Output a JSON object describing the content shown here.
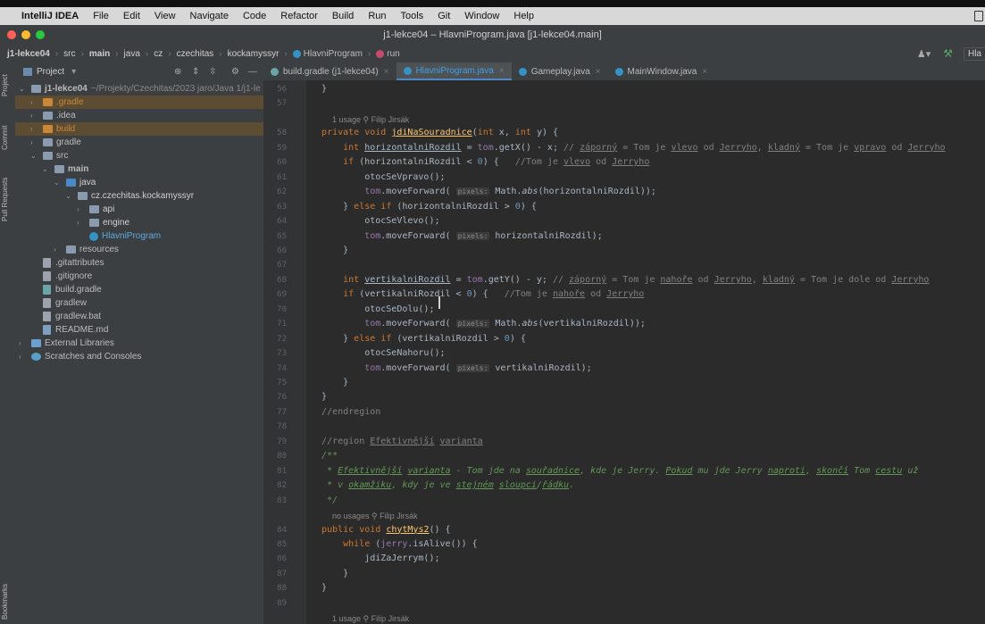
{
  "menubar": {
    "apple": "",
    "app": "IntelliJ IDEA",
    "items": [
      "File",
      "Edit",
      "View",
      "Navigate",
      "Code",
      "Refactor",
      "Build",
      "Run",
      "Tools",
      "Git",
      "Window",
      "Help"
    ]
  },
  "window": {
    "title": "j1-lekce04 – HlavniProgram.java [j1-lekce04.main]"
  },
  "breadcrumbs": [
    "j1-lekce04",
    "src",
    "main",
    "java",
    "cz",
    "czechitas",
    "kockamyssyr",
    "HlavniProgram",
    "run"
  ],
  "navbar_right": {
    "cut_label": "Hla"
  },
  "left_toolbar": [
    "Project",
    "Commit",
    "Pull Requests",
    "Bookmarks"
  ],
  "project_panel": {
    "title": "Project",
    "tree": [
      {
        "label": "j1-lekce04",
        "suffix": "~/Projekty/Czechitas/2023 jaro/Java 1/j1-le",
        "depth": 0,
        "arrow": "down",
        "icon": "module",
        "bold": true
      },
      {
        "label": ".gradle",
        "depth": 1,
        "arrow": "right",
        "icon": "folder-orange",
        "hl": true
      },
      {
        "label": ".idea",
        "depth": 1,
        "arrow": "right",
        "icon": "folder"
      },
      {
        "label": "build",
        "depth": 1,
        "arrow": "right",
        "icon": "folder-orange",
        "hl": true
      },
      {
        "label": "gradle",
        "depth": 1,
        "arrow": "right",
        "icon": "folder"
      },
      {
        "label": "src",
        "depth": 1,
        "arrow": "down",
        "icon": "folder"
      },
      {
        "label": "main",
        "depth": 2,
        "arrow": "down",
        "icon": "folder",
        "bold": true
      },
      {
        "label": "java",
        "depth": 3,
        "arrow": "down",
        "icon": "folder-blue"
      },
      {
        "label": "cz.czechitas.kockamyssyr",
        "depth": 4,
        "arrow": "down",
        "icon": "package"
      },
      {
        "label": "api",
        "depth": 5,
        "arrow": "right",
        "icon": "package"
      },
      {
        "label": "engine",
        "depth": 5,
        "arrow": "right",
        "icon": "package"
      },
      {
        "label": "HlavniProgram",
        "depth": 5,
        "arrow": "none",
        "icon": "class",
        "blue": true
      },
      {
        "label": "resources",
        "depth": 3,
        "arrow": "right",
        "icon": "folder"
      },
      {
        "label": ".gitattributes",
        "depth": 1,
        "arrow": "none",
        "icon": "file"
      },
      {
        "label": ".gitignore",
        "depth": 1,
        "arrow": "none",
        "icon": "file"
      },
      {
        "label": "build.gradle",
        "depth": 1,
        "arrow": "none",
        "icon": "gradle"
      },
      {
        "label": "gradlew",
        "depth": 1,
        "arrow": "none",
        "icon": "file"
      },
      {
        "label": "gradlew.bat",
        "depth": 1,
        "arrow": "none",
        "icon": "file"
      },
      {
        "label": "README.md",
        "depth": 1,
        "arrow": "none",
        "icon": "file-md"
      },
      {
        "label": "External Libraries",
        "depth": 0,
        "arrow": "right",
        "icon": "library"
      },
      {
        "label": "Scratches and Consoles",
        "depth": 0,
        "arrow": "right",
        "icon": "scratch"
      }
    ]
  },
  "tabs": [
    {
      "label": "build.gradle (j1-lekce04)",
      "active": false,
      "icon": "gradle"
    },
    {
      "label": "HlavniProgram.java",
      "active": true,
      "icon": "class"
    },
    {
      "label": "Gameplay.java",
      "active": false,
      "icon": "class"
    },
    {
      "label": "MainWindow.java",
      "active": false,
      "icon": "class"
    }
  ],
  "editor": {
    "lines": [
      {
        "n": "56",
        "t": "  }"
      },
      {
        "n": "57",
        "t": ""
      },
      {
        "meta": "1 usage   ⚲ Filip Jirsák"
      },
      {
        "n": "58",
        "t": "  private void jdiNaSouradnice(int x, int y) {"
      },
      {
        "n": "59",
        "t": "      int horizontalniRozdil = tom.getX() - x; // záporný = Tom je vlevo od Jerryho, kladný = Tom je vpravo od Jerryho"
      },
      {
        "n": "60",
        "t": "      if (horizontalniRozdil < 0) {   //Tom je vlevo od Jerryho"
      },
      {
        "n": "61",
        "t": "          otocSeVpravo();"
      },
      {
        "n": "62",
        "t": "          tom.moveForward( pixels: Math.abs(horizontalniRozdil));"
      },
      {
        "n": "63",
        "t": "      } else if (horizontalniRozdil > 0) {"
      },
      {
        "n": "64",
        "t": "          otocSeVlevo();"
      },
      {
        "n": "65",
        "t": "          tom.moveForward( pixels: horizontalniRozdil);"
      },
      {
        "n": "66",
        "t": "      }"
      },
      {
        "n": "67",
        "t": ""
      },
      {
        "n": "68",
        "t": "      int vertikalniRozdil = tom.getY() - y; // záporný = Tom je nahoře od Jerryho, kladný = Tom je dole od Jerryho"
      },
      {
        "n": "69",
        "t": "      if (vertikalniRozdil < 0) {   //Tom je nahoře od Jerryho"
      },
      {
        "n": "70",
        "t": "          otocSeDolu();"
      },
      {
        "n": "71",
        "t": "          tom.moveForward( pixels: Math.abs(vertikalniRozdil));"
      },
      {
        "n": "72",
        "t": "      } else if (vertikalniRozdil > 0) {"
      },
      {
        "n": "73",
        "t": "          otocSeNahoru();"
      },
      {
        "n": "74",
        "t": "          tom.moveForward( pixels: vertikalniRozdil);"
      },
      {
        "n": "75",
        "t": "      }"
      },
      {
        "n": "76",
        "t": "  }"
      },
      {
        "n": "77",
        "t": "  //endregion"
      },
      {
        "n": "78",
        "t": ""
      },
      {
        "n": "79",
        "t": "  //region Efektivnější varianta"
      },
      {
        "n": "80",
        "t": "  /**"
      },
      {
        "n": "81",
        "t": "   * Efektivnější varianta - Tom jde na souřadnice, kde je Jerry. Pokud mu jde Jerry naproti, skončí Tom cestu už"
      },
      {
        "n": "82",
        "t": "   * v okamžiku, kdy je ve stejném sloupci/řádku."
      },
      {
        "n": "83",
        "t": "   */"
      },
      {
        "meta": "no usages   ⚲ Filip Jirsák"
      },
      {
        "n": "84",
        "t": "  public void chytMys2() {"
      },
      {
        "n": "85",
        "t": "      while (jerry.isAlive()) {"
      },
      {
        "n": "86",
        "t": "          jdiZaJerrym();"
      },
      {
        "n": "87",
        "t": "      }"
      },
      {
        "n": "88",
        "t": "  }"
      },
      {
        "n": "89",
        "t": ""
      },
      {
        "meta": "1 usage   ⚲ Filip Jirsák"
      }
    ]
  },
  "colors": {
    "accent": "#4a88c7",
    "keyword": "#cc7832",
    "method": "#ffc66d",
    "comment": "#808080",
    "doc": "#629755",
    "highlight_folder": "#5c4c32"
  }
}
